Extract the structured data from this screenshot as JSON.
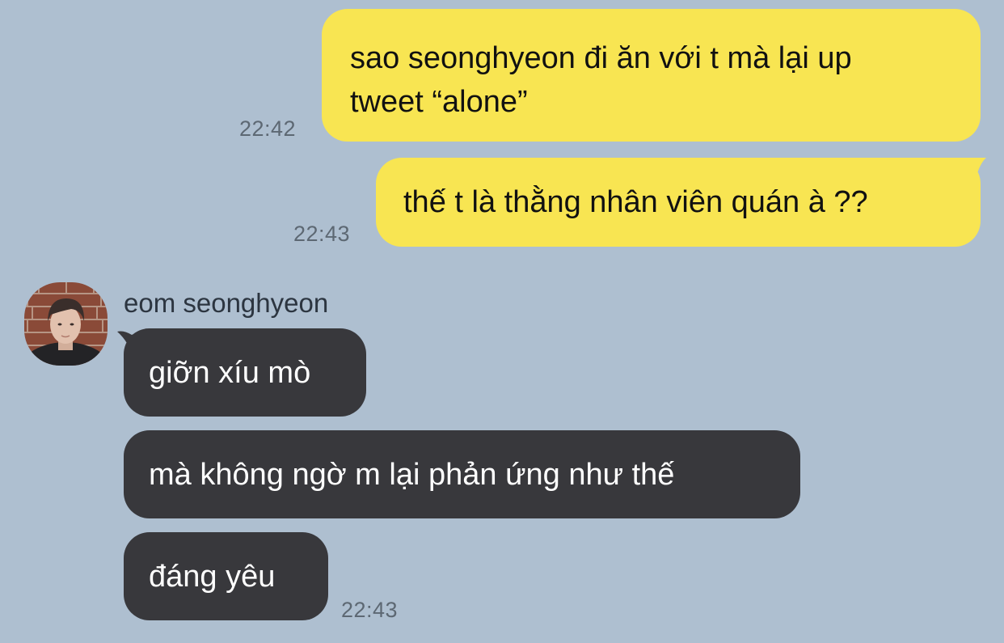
{
  "conversation": {
    "contact_name": "eom seonghyeon",
    "messages": [
      {
        "sender": "me",
        "lines": [
          "sao seonghyeon đi ăn với t mà lại up",
          "tweet “alone”"
        ],
        "time": "22:42"
      },
      {
        "sender": "me",
        "lines": [
          "thế t là thằng nhân viên quán à ??"
        ],
        "time": "22:43"
      },
      {
        "sender": "eom seonghyeon",
        "lines": [
          "giỡn xíu mò"
        ]
      },
      {
        "sender": "eom seonghyeon",
        "lines": [
          "mà không ngờ m lại phản ứng như thế"
        ]
      },
      {
        "sender": "eom seonghyeon",
        "lines": [
          "đáng yêu"
        ],
        "time": "22:43"
      }
    ]
  },
  "colors": {
    "background": "#aebfd0",
    "my_bubble": "#f8e552",
    "their_bubble": "#38383c",
    "timestamp": "#5d6873"
  },
  "icons": {
    "avatar": "contact-avatar-photo"
  }
}
